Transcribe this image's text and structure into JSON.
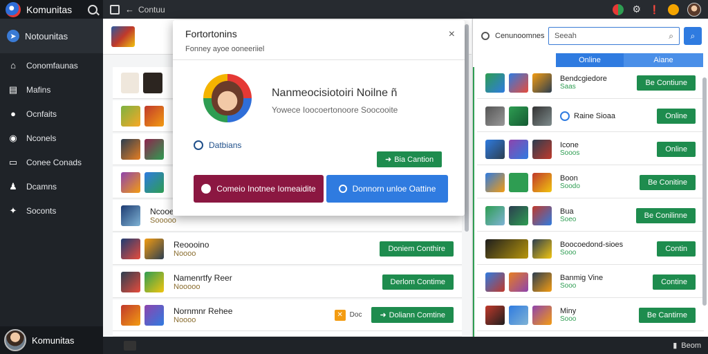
{
  "app": {
    "title": "Komunitas"
  },
  "sidebar": {
    "brand": "Notounitas",
    "items": [
      {
        "label": "Conomfaunas",
        "icon": "home-icon"
      },
      {
        "label": "Mafins",
        "icon": "bookmark-icon"
      },
      {
        "label": "Ocnfaits",
        "icon": "chat-icon"
      },
      {
        "label": "Nconels",
        "icon": "target-icon"
      },
      {
        "label": "Conee Conads",
        "icon": "screen-icon"
      },
      {
        "label": "Dcamns",
        "icon": "user-icon"
      },
      {
        "label": "Soconts",
        "icon": "share-icon"
      }
    ],
    "user": {
      "name": "Komunitas"
    }
  },
  "topbar": {
    "address": "Contuu"
  },
  "left_list": {
    "rows": [
      {
        "name": "Ncooeerr",
        "sub": "Sooooo",
        "btn": ""
      },
      {
        "name": "Reoooino",
        "sub": "Noooo",
        "btn": "Doniem Conthire"
      },
      {
        "name": "Namenrtfy Reer",
        "sub": "Nooooo",
        "btn": "Derlom Contime"
      },
      {
        "name": "Nornmnr Rehee",
        "sub": "Noooo",
        "btn": "Doliann Comtine",
        "badge": "Doc"
      }
    ]
  },
  "modal": {
    "title": "Fortortonins",
    "subtitle": "Fonney ayoe ooneeriiel",
    "close": "×",
    "name": "Nanmeocisiotoiri Noilne ñ",
    "desc": "Yowece Ioocoertonoore Soocooite",
    "link": "Datbians",
    "small_btn": "Bia Cantion",
    "btn_primary": "Comeio Inotnee Iomeaidite",
    "btn_secondary": "Donnorn unloe Oattine"
  },
  "right_pane": {
    "header_label": "Cenunoomnes",
    "search_placeholder": "Seeah",
    "tabs": [
      "Online",
      "Aiane"
    ],
    "rows": [
      {
        "name": "Bendcgiedore",
        "sub": "Saas",
        "btn": "Be Contiune"
      },
      {
        "name": "Raine Sioaa",
        "sub": "",
        "btn": "Online"
      },
      {
        "name": "Icone",
        "sub": "Sooos",
        "btn": "Online"
      },
      {
        "name": "Boon",
        "sub": "Soodo",
        "btn": "Be Conitine"
      },
      {
        "name": "Bua",
        "sub": "Soeo",
        "btn": "Be Conilinne"
      },
      {
        "name": "Boocoedond-sioes",
        "sub": "Sooo",
        "btn": "Contin"
      },
      {
        "name": "Banmig Vine",
        "sub": "Sooo",
        "btn": "Contine"
      },
      {
        "name": "Miny",
        "sub": "Sooo",
        "btn": "Be Cantirne"
      }
    ]
  },
  "bottombar": {
    "right_label": "Beom"
  }
}
